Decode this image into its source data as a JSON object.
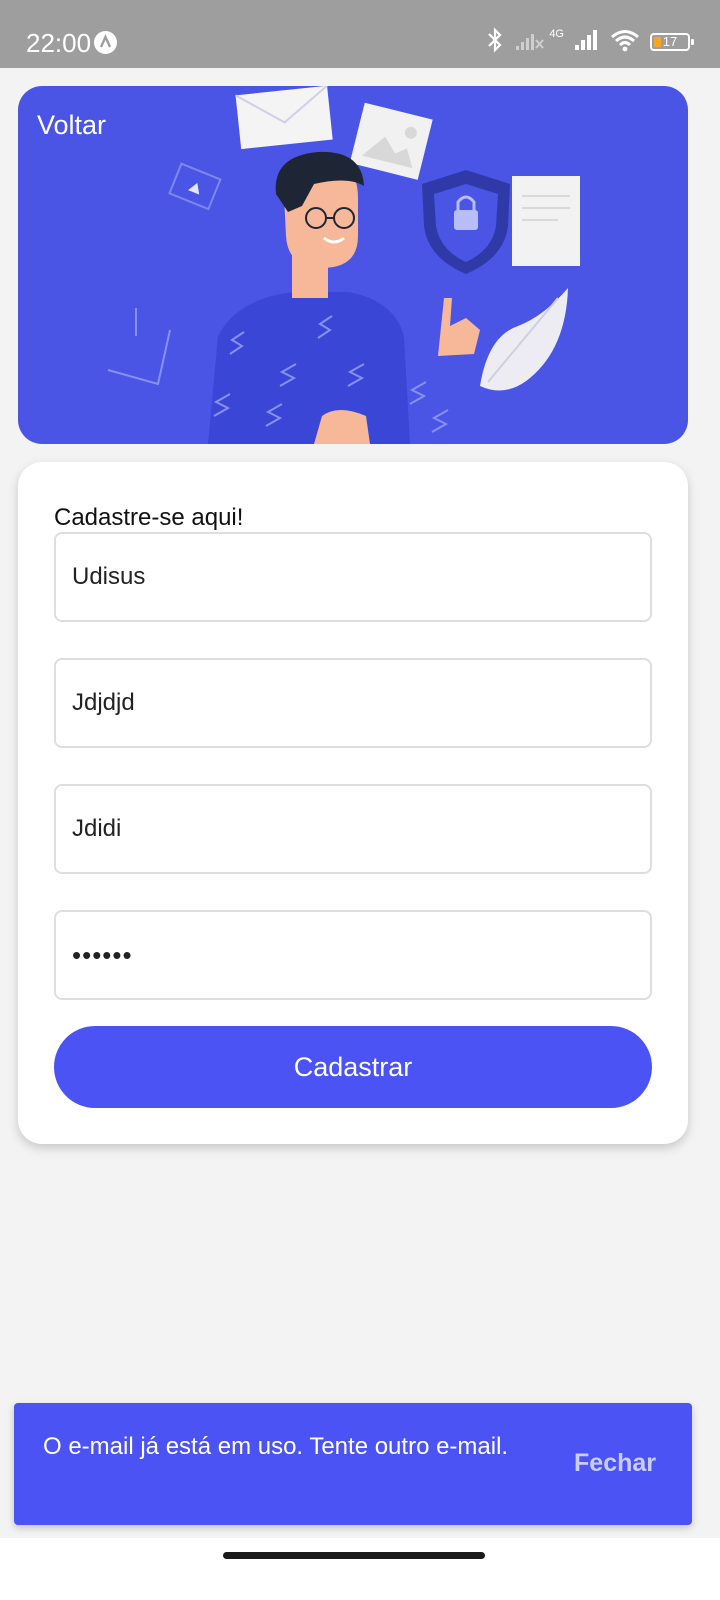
{
  "status_bar": {
    "time": "22:00",
    "battery": "17",
    "network": "4G",
    "icons": [
      "app-alert-icon",
      "bluetooth-icon",
      "signal-no-service-icon",
      "signal-4g-icon",
      "wifi-icon",
      "battery-icon"
    ]
  },
  "hero": {
    "back_label": "Voltar",
    "illustration": "person-with-security-shield-illustration",
    "colors": {
      "background": "#4a55e6"
    }
  },
  "form": {
    "title": "Cadastre-se aqui!",
    "fields": [
      {
        "value": "Udisus"
      },
      {
        "value": "Jdjdjd"
      },
      {
        "value": "Jdidi"
      },
      {
        "value": "••••••",
        "type": "password"
      }
    ],
    "submit_label": "Cadastrar",
    "colors": {
      "accent": "#4b53f5"
    }
  },
  "snackbar": {
    "message": "O e-mail já está em uso. Tente outro e-mail.",
    "action_label": "Fechar"
  }
}
